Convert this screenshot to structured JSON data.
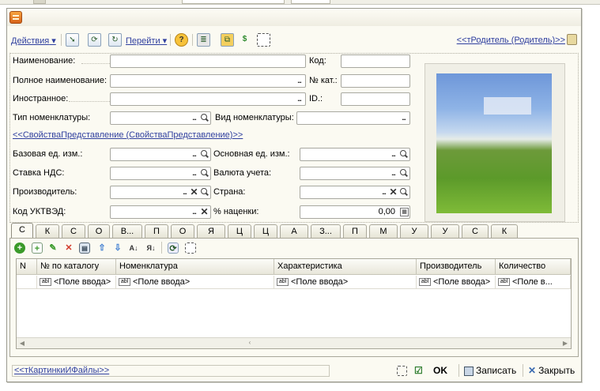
{
  "toolbar": {
    "actions_label": "Действия",
    "goto_label": "Перейти",
    "help_icon": "?",
    "dollar_icon": "$",
    "parent_link": "<<тРодитель (Родитель)>>"
  },
  "form": {
    "name_label": "Наименование:",
    "code_label": "Код:",
    "full_name_label": "Полное наименование:",
    "cat_no_label": "№ кат.:",
    "foreign_label": "Иностранное:",
    "id_label": "ID.:",
    "nom_type_label": "Тип номенклатуры:",
    "nom_kind_label": "Вид номенклатуры:",
    "properties_link": "<<СвойстваПредставление (СвойстваПредставление)>>",
    "base_unit_label": "Базовая ед. изм.:",
    "main_unit_label": "Основная ед. изм.:",
    "vat_label": "Ставка НДС:",
    "currency_label": "Валюта учета:",
    "producer_label": "Производитель:",
    "country_label": "Страна:",
    "code_ukt_label": "Код УКТВЭД:",
    "markup_label": "% наценки:",
    "markup_value": "0,00",
    "ellipsis": "...",
    "clear_x": "✕"
  },
  "tabs": [
    "С",
    "К",
    "С",
    "О",
    "В...",
    "П",
    "О",
    "Я",
    "Ц",
    "Ц",
    "А",
    "З...",
    "П",
    "М",
    "У",
    "У",
    "С",
    "К"
  ],
  "table": {
    "columns": [
      "N",
      "№ по каталогу",
      "Номенклатура",
      "Характеристика",
      "Производитель",
      "Количество"
    ],
    "row": [
      "",
      "<Поле ввода>",
      "<Поле ввода>",
      "<Поле ввода>",
      "<Поле ввода>",
      "<Поле в..."
    ],
    "abl": "abl"
  },
  "bottom": {
    "pictures_link": "<<тКартинкиИФайлы>>",
    "ok_label": "OK",
    "save_label": "Записать",
    "close_label": "Закрыть"
  },
  "colors": {
    "link": "#2f3f9f",
    "window_bg": "#fbfaf2",
    "add_green": "#3a9a2a",
    "delete_red": "#d23a2a",
    "arrow_blue": "#3a7ad0"
  }
}
